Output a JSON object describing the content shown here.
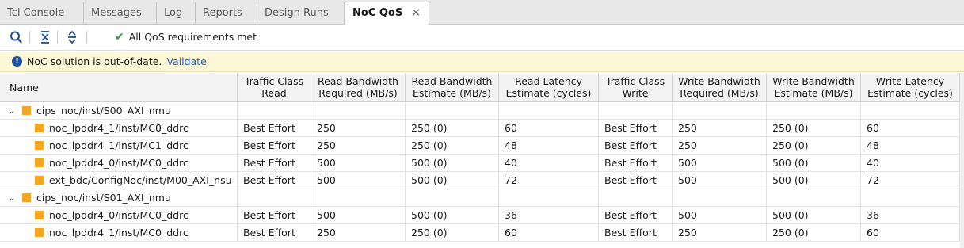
{
  "tabs": [
    {
      "label": "Tcl Console"
    },
    {
      "label": "Messages"
    },
    {
      "label": "Log"
    },
    {
      "label": "Reports"
    },
    {
      "label": "Design Runs"
    },
    {
      "label": "NoC QoS",
      "close": "×"
    }
  ],
  "toolbar": {
    "icons": [
      "search-icon",
      "collapse-all-icon",
      "expand-all-icon"
    ],
    "status": "All QoS requirements met",
    "status_icon": "check-icon",
    "status_color": "#2e9e3a"
  },
  "banner": {
    "message": "NoC solution is out-of-date.",
    "link": "Validate",
    "icon": "info-icon"
  },
  "table": {
    "headers": [
      "Name",
      "Traffic Class\nRead",
      "Read Bandwidth\nRequired (MB/s)",
      "Read Bandwidth\nEstimate (MB/s)",
      "Read Latency\nEstimate (cycles)",
      "Traffic Class\nWrite",
      "Write Bandwidth\nRequired (MB/s)",
      "Write Bandwidth\nEstimate (MB/s)",
      "Write Latency\nEstimate (cycles)"
    ],
    "rows": [
      {
        "level": 0,
        "expanded": true,
        "name": "cips_noc/inst/S00_AXI_nmu",
        "cells": [
          "",
          "",
          "",
          "",
          "",
          "",
          "",
          ""
        ]
      },
      {
        "level": 1,
        "name": "noc_lpddr4_1/inst/MC0_ddrc",
        "cells": [
          "Best Effort",
          "250",
          "250 (0)",
          "60",
          "Best Effort",
          "250",
          "250 (0)",
          "60"
        ]
      },
      {
        "level": 1,
        "name": "noc_lpddr4_1/inst/MC1_ddrc",
        "cells": [
          "Best Effort",
          "250",
          "250 (0)",
          "48",
          "Best Effort",
          "250",
          "250 (0)",
          "48"
        ]
      },
      {
        "level": 1,
        "name": "noc_lpddr4_0/inst/MC0_ddrc",
        "cells": [
          "Best Effort",
          "500",
          "500 (0)",
          "40",
          "Best Effort",
          "500",
          "500 (0)",
          "40"
        ]
      },
      {
        "level": 1,
        "name": "ext_bdc/ConfigNoc/inst/M00_AXI_nsu",
        "cells": [
          "Best Effort",
          "500",
          "500 (0)",
          "72",
          "Best Effort",
          "500",
          "500 (0)",
          "72"
        ]
      },
      {
        "level": 0,
        "expanded": true,
        "name": "cips_noc/inst/S01_AXI_nmu",
        "cells": [
          "",
          "",
          "",
          "",
          "",
          "",
          "",
          ""
        ]
      },
      {
        "level": 1,
        "name": "noc_lpddr4_0/inst/MC0_ddrc",
        "cells": [
          "Best Effort",
          "500",
          "500 (0)",
          "36",
          "Best Effort",
          "500",
          "500 (0)",
          "36"
        ]
      },
      {
        "level": 1,
        "name": "noc_lpddr4_1/inst/MC0_ddrc",
        "cells": [
          "Best Effort",
          "250",
          "250 (0)",
          "60",
          "Best Effort",
          "250",
          "250 (0)",
          "60"
        ]
      }
    ]
  },
  "colors": {
    "node_square": "#f5a623",
    "banner_bg": "#fcf7d6",
    "link": "#1d5fbf"
  }
}
